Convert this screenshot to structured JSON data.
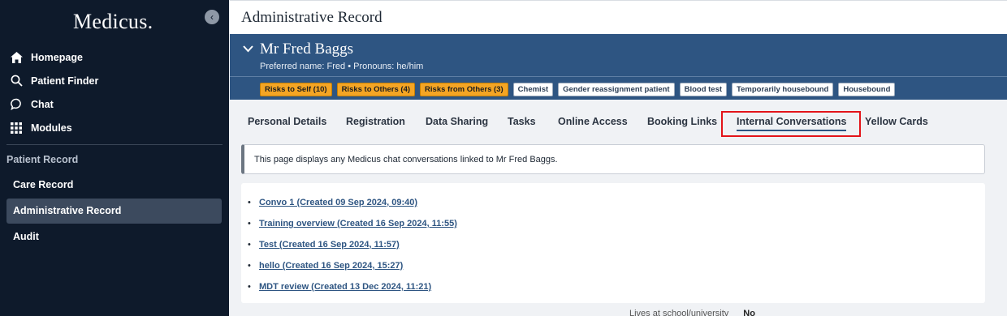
{
  "sidebar": {
    "logo": "Medicus.",
    "collapse_icon": "‹",
    "nav": [
      {
        "label": "Homepage",
        "icon": "home-icon"
      },
      {
        "label": "Patient Finder",
        "icon": "search-icon"
      },
      {
        "label": "Chat",
        "icon": "chat-icon"
      },
      {
        "label": "Modules",
        "icon": "grid-icon"
      }
    ],
    "section_title": "Patient Record",
    "record_items": [
      {
        "label": "Care Record",
        "active": false
      },
      {
        "label": "Administrative Record",
        "active": true
      },
      {
        "label": "Audit",
        "active": false
      }
    ]
  },
  "header": {
    "title": "Administrative Record"
  },
  "patient": {
    "name": "Mr Fred Baggs",
    "preferred": "Preferred name: Fred • Pronouns: he/him",
    "tags": [
      {
        "label": "Risks to Self (10)",
        "kind": "risk"
      },
      {
        "label": "Risks to Others (4)",
        "kind": "risk"
      },
      {
        "label": "Risks from Others (3)",
        "kind": "risk"
      },
      {
        "label": "Chemist",
        "kind": "plain"
      },
      {
        "label": "Gender reassignment patient",
        "kind": "plain"
      },
      {
        "label": "Blood test",
        "kind": "plain"
      },
      {
        "label": "Temporarily housebound",
        "kind": "plain"
      },
      {
        "label": "Housebound",
        "kind": "plain"
      }
    ]
  },
  "tabs": [
    {
      "label": "Personal Details"
    },
    {
      "label": "Registration"
    },
    {
      "label": "Data Sharing"
    },
    {
      "label": "Tasks"
    },
    {
      "label": "Online Access"
    },
    {
      "label": "Booking Links"
    },
    {
      "label": "Internal Conversations",
      "active": true
    },
    {
      "label": "Yellow Cards"
    }
  ],
  "info_text": "This page displays any Medicus chat conversations linked to Mr Fred Baggs.",
  "conversations": [
    "Convo 1 (Created 09 Sep 2024, 09:40)",
    "Training overview (Created 16 Sep 2024, 11:55)",
    "Test (Created 16 Sep 2024, 11:57)",
    "hello (Created 16 Sep 2024, 15:27)",
    "MDT review (Created 13 Dec 2024, 11:21)"
  ],
  "peek": {
    "label": "Lives at school/university",
    "value": "No"
  },
  "colors": {
    "sidebar_bg": "#0e1a2b",
    "banner_bg": "#2e5582",
    "risk_tag": "#f4a524",
    "highlight": "#e3141a",
    "link": "#2e5582"
  }
}
